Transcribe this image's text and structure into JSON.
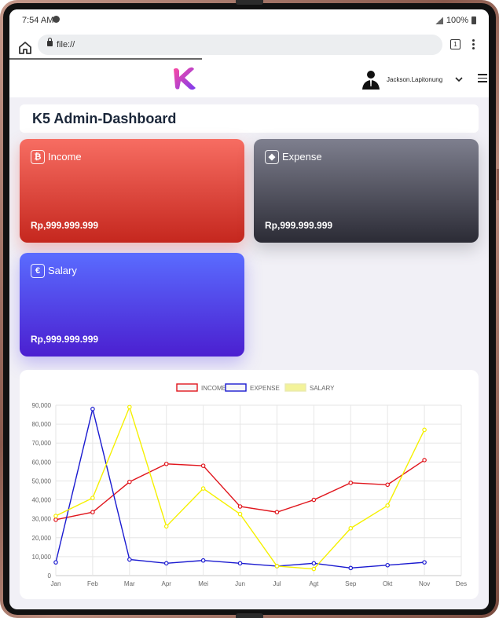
{
  "status": {
    "time": "7:54 AM",
    "battery": "100%"
  },
  "browser": {
    "url": "file://",
    "tab_count": "1"
  },
  "header": {
    "username": "Jackson.Lapitonung"
  },
  "page": {
    "title": "K5 Admin-Dashboard"
  },
  "cards": [
    {
      "label": "Income",
      "value": "Rp,999.999.999",
      "icon": "bitcoin-icon"
    },
    {
      "label": "Expense",
      "value": "Rp,999.999.999",
      "icon": "ethereum-icon"
    },
    {
      "label": "Salary",
      "value": "Rp,999.999.999",
      "icon": "euro-icon"
    }
  ],
  "chart_data": {
    "type": "line",
    "categories": [
      "Jan",
      "Feb",
      "Mar",
      "Apr",
      "Mei",
      "Jun",
      "Jul",
      "Agt",
      "Sep",
      "Okt",
      "Nov",
      "Des"
    ],
    "ylim": [
      0,
      90000
    ],
    "yticks": [
      "0",
      "10,000",
      "20,000",
      "30,000",
      "40,000",
      "50,000",
      "60,000",
      "70,000",
      "80,000",
      "90,000"
    ],
    "grid": true,
    "legend_position": "top",
    "series": [
      {
        "name": "INCOME",
        "color": "#e0161d",
        "values": [
          29500,
          33500,
          49500,
          59000,
          58000,
          36500,
          33500,
          40000,
          49000,
          48000,
          61000
        ]
      },
      {
        "name": "EXPENSE",
        "color": "#1a1ad0",
        "values": [
          7000,
          88000,
          8500,
          6500,
          8000,
          6500,
          5000,
          6500,
          4000,
          5500,
          7000
        ]
      },
      {
        "name": "SALARY",
        "color": "#f5f000",
        "values": [
          31500,
          41000,
          89000,
          26000,
          46000,
          32500,
          5000,
          3500,
          25000,
          37000,
          77000
        ]
      }
    ]
  }
}
